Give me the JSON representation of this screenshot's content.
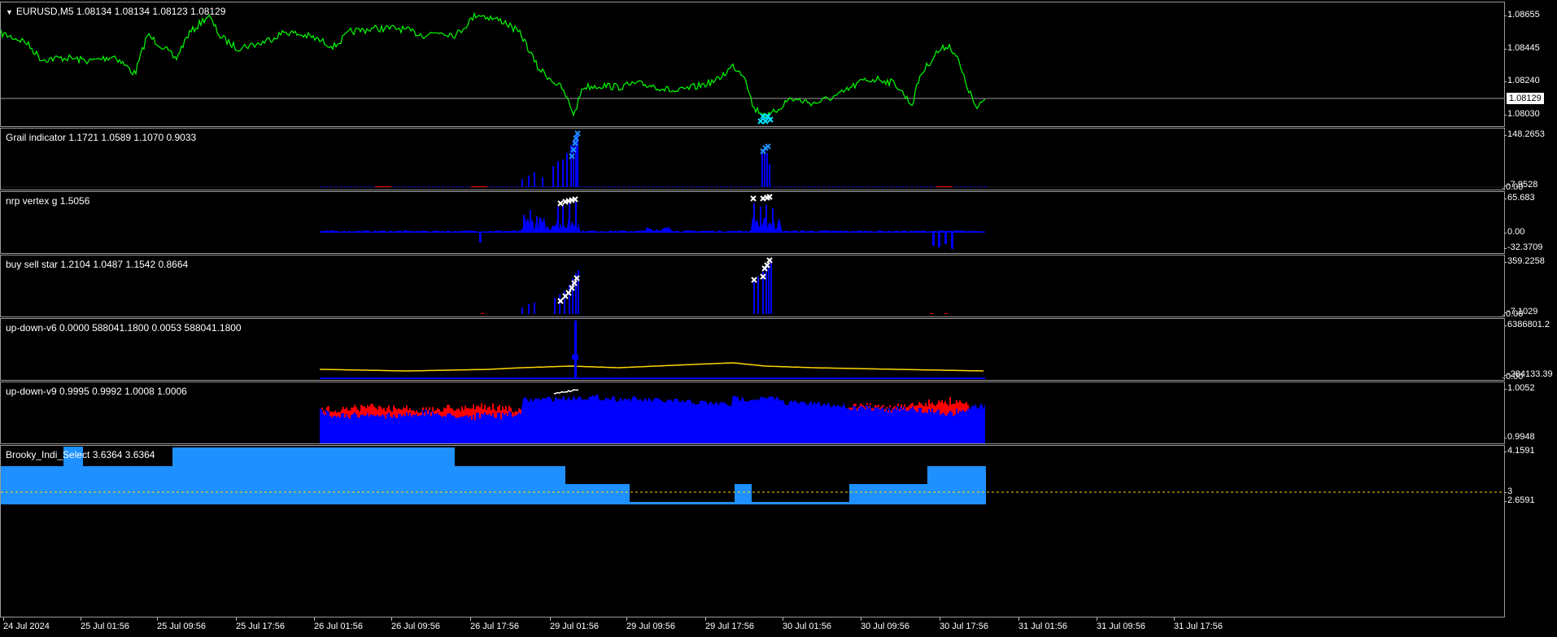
{
  "main": {
    "title": "EURUSD,M5  1.08134 1.08134 1.08123 1.08129",
    "price_ticks": [
      "1.08655",
      "1.08445",
      "1.08240",
      "1.08030"
    ],
    "current_price": "1.08129",
    "line_color": "#00ff00",
    "marker_color": "#00e5ff"
  },
  "panes": [
    {
      "id": "grail",
      "title": "Grail indicator 1.1721 1.0589 1.1070 0.9033",
      "ticks": [
        "148.2653",
        "-7.9528",
        "0.00"
      ],
      "bar_color": "#0000ff",
      "mark_color": "#1e90ff"
    },
    {
      "id": "nrp",
      "title": "nrp vertex g 1.5056",
      "ticks": [
        "65.683",
        "0.00",
        "-32.3709"
      ],
      "bar_color": "#0000ff",
      "mark_color": "#ffffff"
    },
    {
      "id": "bss",
      "title": "buy sell star 1.2104 1.0487 1.1542 0.8664",
      "ticks": [
        "359.2258",
        "-7.1029",
        "0.00"
      ],
      "bar_color": "#0000ff",
      "mark_color": "#ffffff"
    },
    {
      "id": "v6",
      "title": "up-down-v6 0.0000 588041.1800 0.0053 588041.1800",
      "ticks": [
        "6386801.2",
        "-284133.39",
        "0.00"
      ],
      "bar_color": "#0000ff",
      "line_color": "#ffd700"
    },
    {
      "id": "v9",
      "title": "up-down-v9 0.9995 0.9992 1.0008 1.0006",
      "ticks": [
        "1.0052",
        "0.9948"
      ],
      "bar_color": "#0000ff",
      "alt_color": "#ff0000"
    },
    {
      "id": "brooky",
      "title": "Brooky_Indi_Select 3.6364 3.6364",
      "ticks": [
        "4.1591",
        "3",
        "2.6591"
      ],
      "bar_color": "#1e90ff",
      "level_color": "#ffd700"
    }
  ],
  "time_labels": [
    "24 Jul 2024",
    "25 Jul 01:56",
    "25 Jul 09:56",
    "25 Jul 17:56",
    "26 Jul 01:56",
    "26 Jul 09:56",
    "26 Jul 17:56",
    "29 Jul 01:56",
    "29 Jul 09:56",
    "29 Jul 17:56",
    "30 Jul 01:56",
    "30 Jul 09:56",
    "30 Jul 17:56",
    "31 Jul 01:56",
    "31 Jul 09:56",
    "31 Jul 17:56"
  ]
}
